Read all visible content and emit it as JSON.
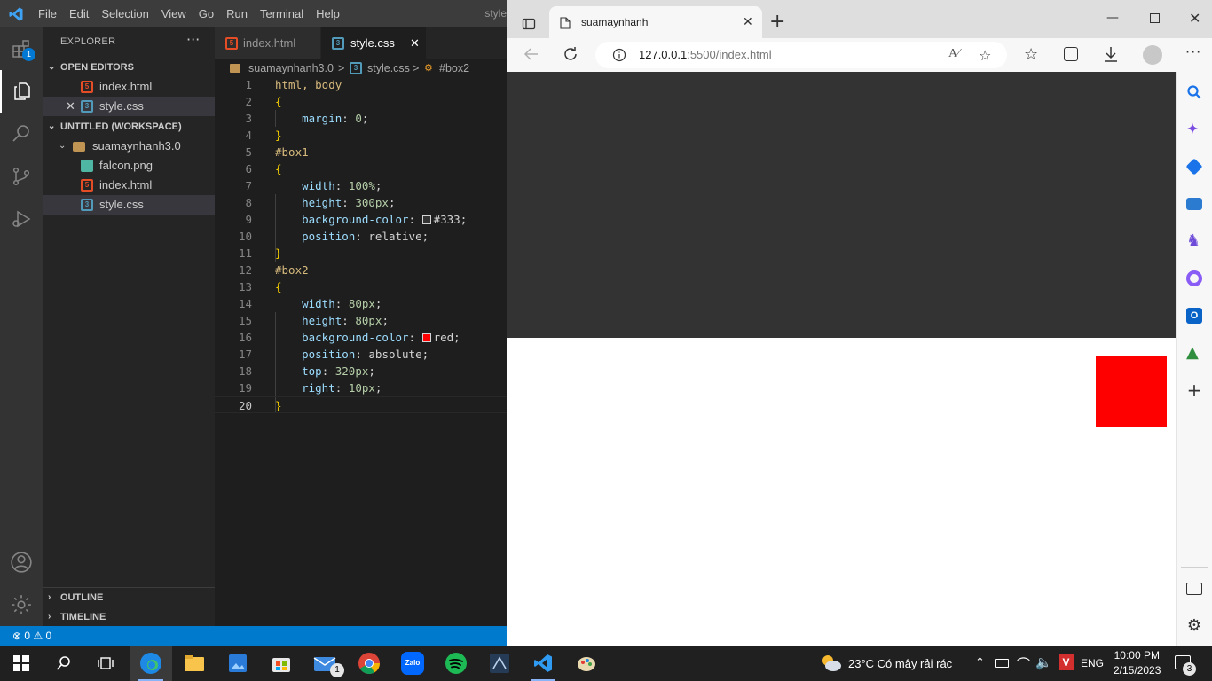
{
  "vscode": {
    "menu": [
      "File",
      "Edit",
      "Selection",
      "View",
      "Go",
      "Run",
      "Terminal",
      "Help"
    ],
    "window_title": "style",
    "activity_badge": "1",
    "explorer": {
      "title": "EXPLORER",
      "more": "···",
      "open_editors_label": "OPEN EDITORS",
      "open_editors": [
        {
          "name": "index.html",
          "type": "html"
        },
        {
          "name": "style.css",
          "type": "css",
          "close": "✕"
        }
      ],
      "workspace_label": "UNTITLED (WORKSPACE)",
      "folder": "suamaynhanh3.0",
      "files": [
        {
          "name": "falcon.png",
          "type": "png"
        },
        {
          "name": "index.html",
          "type": "html"
        },
        {
          "name": "style.css",
          "type": "css"
        }
      ],
      "outline_label": "OUTLINE",
      "timeline_label": "TIMELINE"
    },
    "tabs": [
      {
        "label": "index.html",
        "type": "html"
      },
      {
        "label": "style.css",
        "type": "css",
        "close": "✕"
      }
    ],
    "breadcrumb": {
      "folder": "suamaynhanh3.0",
      "file": "style.css",
      "symbol": "#box2",
      "sep": ">"
    },
    "code": {
      "line_numbers": [
        "1",
        "2",
        "3",
        "4",
        "5",
        "6",
        "7",
        "8",
        "9",
        "10",
        "11",
        "12",
        "13",
        "14",
        "15",
        "16",
        "17",
        "18",
        "19",
        "20"
      ],
      "l1": "html, body",
      "l3p": "margin",
      "l3v": "0",
      "l5": "#box1",
      "l7p": "width",
      "l7v": "100%",
      "l8p": "height",
      "l8v": "300px",
      "l9p": "background-color",
      "l9v": "#333",
      "l10p": "position",
      "l10v": "relative",
      "l12": "#box2",
      "l14p": "width",
      "l14v": "80px",
      "l15p": "height",
      "l15v": "80px",
      "l16p": "background-color",
      "l16v": "red",
      "l17p": "position",
      "l17v": "absolute",
      "l18p": "top",
      "l18v": "320px",
      "l19p": "right",
      "l19v": "10px",
      "open": "{",
      "close": "}",
      "colon": ": ",
      "semi": ";"
    },
    "status": {
      "errors": "0",
      "warnings": "0"
    }
  },
  "edge": {
    "tab_title": "suamaynhanh",
    "tab_close": "✕",
    "new_tab": "+",
    "url_host": "127.0.0.1",
    "url_rest": ":5500/index.html",
    "page": {
      "box1_color": "#333333",
      "box2_color": "#ff0000"
    }
  },
  "taskbar": {
    "weather": "23°C  Có mây rải rác",
    "lang": "ENG",
    "time": "10:00 PM",
    "date": "2/15/2023",
    "notif_count": "3",
    "mail_badge": "1",
    "zalo_label": "Zalo"
  },
  "colors": {
    "vs_blue": "#007acc",
    "accent": "#0078d4"
  }
}
